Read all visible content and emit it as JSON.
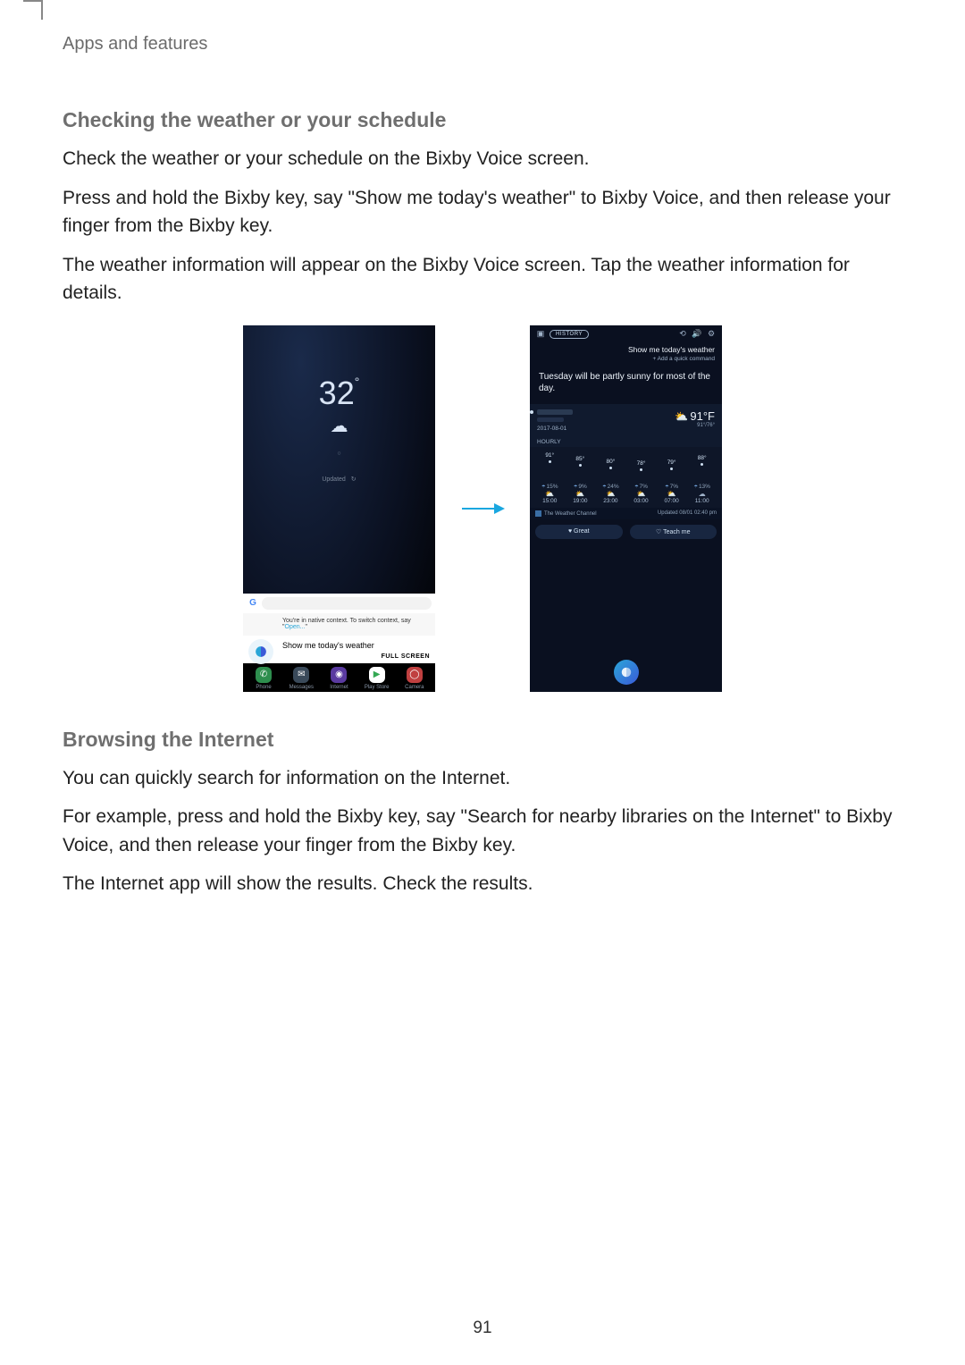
{
  "breadcrumb": "Apps and features",
  "section1": {
    "heading": "Checking the weather or your schedule",
    "p1": "Check the weather or your schedule on the Bixby Voice screen.",
    "p2": "Press and hold the Bixby key, say \"Show me today's weather\" to Bixby Voice, and then release your finger from the Bixby key.",
    "p3": "The weather information will appear on the Bixby Voice screen. Tap the weather information for details."
  },
  "home_screen": {
    "temperature": "32",
    "degree": "°",
    "weather_icon": "☁",
    "location_placeholder": "○",
    "updated_label": "Updated",
    "refresh_icon": "↻",
    "google_badge": "G",
    "context_note_prefix": "You're in native context. To switch context, say \"",
    "context_note_open": "Open...",
    "context_note_suffix": "\"",
    "command_text": "Show me today's weather",
    "full_screen_label": "FULL SCREEN",
    "dock": [
      {
        "label": "Phone",
        "icon": "✆"
      },
      {
        "label": "Messages",
        "icon": "✉"
      },
      {
        "label": "Internet",
        "icon": "◉"
      },
      {
        "label": "Play Store",
        "icon": "▶"
      },
      {
        "label": "Camera",
        "icon": "◯"
      }
    ]
  },
  "bixby_screen": {
    "history_label": "HISTORY",
    "query": "Show me today's weather",
    "add_command": "+  Add a quick command",
    "summary": "Tuesday will be partly sunny for most of the day.",
    "date": "2017-08-01",
    "now_temp": "91°F",
    "now_sub": "91°/76°",
    "now_icon": "⛅",
    "hourly_label": "HOURLY",
    "hourly": {
      "temps": [
        "91°",
        "85°",
        "80°",
        "78°",
        "79°",
        "88°"
      ],
      "precip": [
        "15%",
        "9%",
        "24%",
        "7%",
        "7%",
        "13%"
      ],
      "icons": [
        "⛅",
        "⛅",
        "⛅",
        "⛅",
        "⛅",
        "☁"
      ],
      "times": [
        "15:00",
        "19:00",
        "23:00",
        "03:00",
        "07:00",
        "11:00"
      ]
    },
    "provider": "The Weather Channel",
    "updated": "Updated  08/01 02:40 pm",
    "feedback_great": "♥  Great",
    "feedback_teach": "♡  Teach me"
  },
  "section2": {
    "heading": "Browsing the Internet",
    "p1": "You can quickly search for information on the Internet.",
    "p2": "For example, press and hold the Bixby key, say \"Search for nearby libraries on the Internet\" to Bixby Voice, and then release your finger from the Bixby key.",
    "p3": "The Internet app will show the results. Check the results."
  },
  "page_number": "91"
}
